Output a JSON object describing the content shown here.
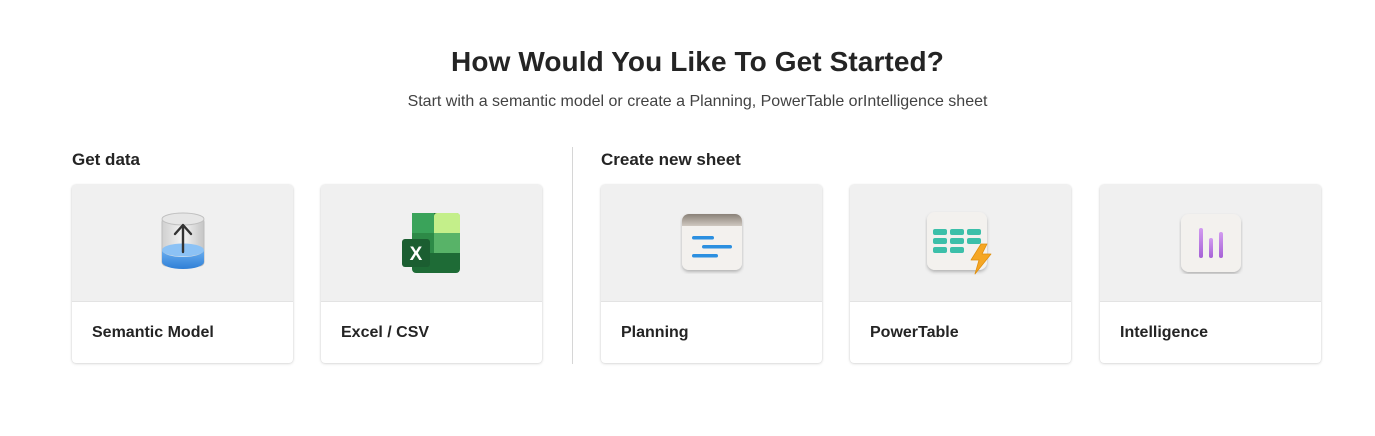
{
  "header": {
    "title": "How Would You Like To Get Started?",
    "subtitle": "Start with a semantic model or create a Planning, PowerTable orIntelligence sheet"
  },
  "sections": {
    "get_data": {
      "label": "Get data",
      "cards": [
        {
          "label": "Semantic Model",
          "icon": "semantic-model-icon"
        },
        {
          "label": "Excel / CSV",
          "icon": "excel-icon"
        }
      ]
    },
    "create_sheet": {
      "label": "Create new sheet",
      "cards": [
        {
          "label": "Planning",
          "icon": "planning-icon"
        },
        {
          "label": "PowerTable",
          "icon": "powertable-icon"
        },
        {
          "label": "Intelligence",
          "icon": "intelligence-icon"
        }
      ]
    }
  },
  "colors": {
    "card_top": "#f0f0f0",
    "excel_green": "#1e6b36",
    "planning_blue": "#2b8fe0",
    "powertable_teal": "#3cbfa9",
    "powertable_bolt": "#f5a623",
    "intelligence_purple": "#b57de0"
  }
}
